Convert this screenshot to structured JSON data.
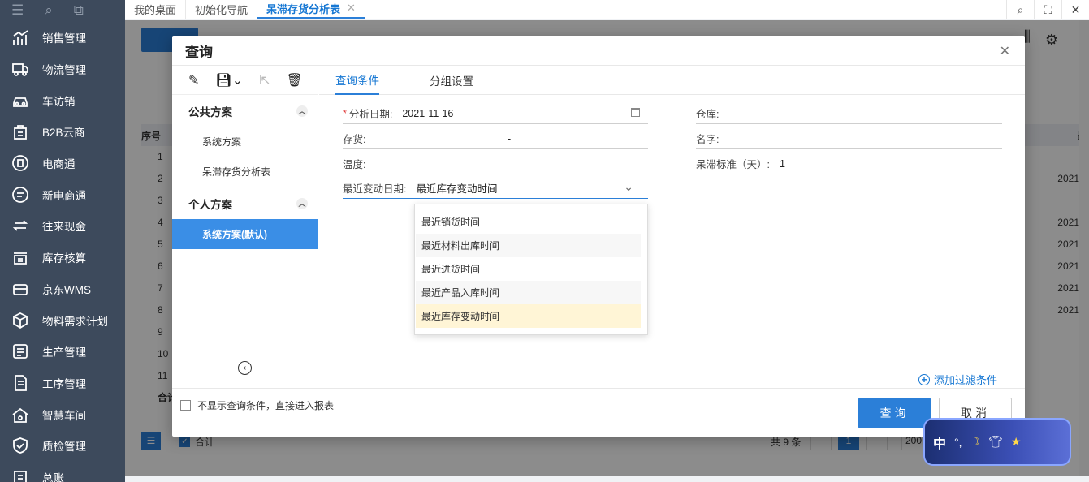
{
  "sidebar": {
    "items": [
      {
        "label": "销售管理",
        "icon": "bar-chart-icon"
      },
      {
        "label": "物流管理",
        "icon": "truck-icon"
      },
      {
        "label": "车访销",
        "icon": "car-icon"
      },
      {
        "label": "B2B云商",
        "icon": "shop-bag-icon"
      },
      {
        "label": "电商通",
        "icon": "ecommerce-icon"
      },
      {
        "label": "新电商通",
        "icon": "new-ecommerce-icon"
      },
      {
        "label": "往来现金",
        "icon": "exchange-icon"
      },
      {
        "label": "库存核算",
        "icon": "warehouse-icon"
      },
      {
        "label": "京东WMS",
        "icon": "delivery-icon"
      },
      {
        "label": "物料需求计划",
        "icon": "box-icon"
      },
      {
        "label": "生产管理",
        "icon": "production-icon"
      },
      {
        "label": "工序管理",
        "icon": "process-icon"
      },
      {
        "label": "智慧车间",
        "icon": "factory-icon"
      },
      {
        "label": "质检管理",
        "icon": "shield-check-icon"
      },
      {
        "label": "总账",
        "icon": "ledger-icon"
      }
    ]
  },
  "tabs": [
    {
      "label": "我的桌面"
    },
    {
      "label": "初始化导航"
    },
    {
      "label": "呆滞存货分析表",
      "active": true
    }
  ],
  "background": {
    "row_numbers": [
      "1",
      "2",
      "3",
      "4",
      "5",
      "6",
      "7",
      "8",
      "9",
      "10",
      "11"
    ],
    "header_seq": "序号",
    "header_right": "最",
    "year_values": [
      "2021",
      "2021",
      "2021",
      "2021",
      "2021",
      "2021"
    ],
    "total_label": "合计",
    "summary_checkbox_label": "合计",
    "count_text": "共 9 条",
    "page": "1",
    "page_size": "200"
  },
  "dialog": {
    "title": "查询",
    "left": {
      "public_group": "公共方案",
      "public_items": [
        "系统方案",
        "呆滞存货分析表"
      ],
      "personal_group": "个人方案",
      "personal_items": [
        "系统方案(默认)"
      ]
    },
    "tabs": [
      "查询条件",
      "分组设置"
    ],
    "fields": {
      "analysis_date_label": "分析日期:",
      "analysis_date_value": "2021-11-16",
      "warehouse_label": "仓库:",
      "inventory_label": "存货:",
      "inventory_value": "-",
      "name_label": "名字:",
      "temperature_label": "温度:",
      "stale_label": "呆滞标准（天）:",
      "stale_value": "1",
      "recent_change_label": "最近变动日期:",
      "recent_change_value": "最近库存变动时间"
    },
    "dropdown_options": [
      "最近销货时间",
      "最近材料出库时间",
      "最近进货时间",
      "最近产品入库时间",
      "最近库存变动时间"
    ],
    "add_filter": "添加过滤条件",
    "skip_checkbox_label": "不显示查询条件，直接进入报表",
    "query_button": "查询",
    "cancel_button": "取消"
  },
  "ime": {
    "label": "中"
  }
}
